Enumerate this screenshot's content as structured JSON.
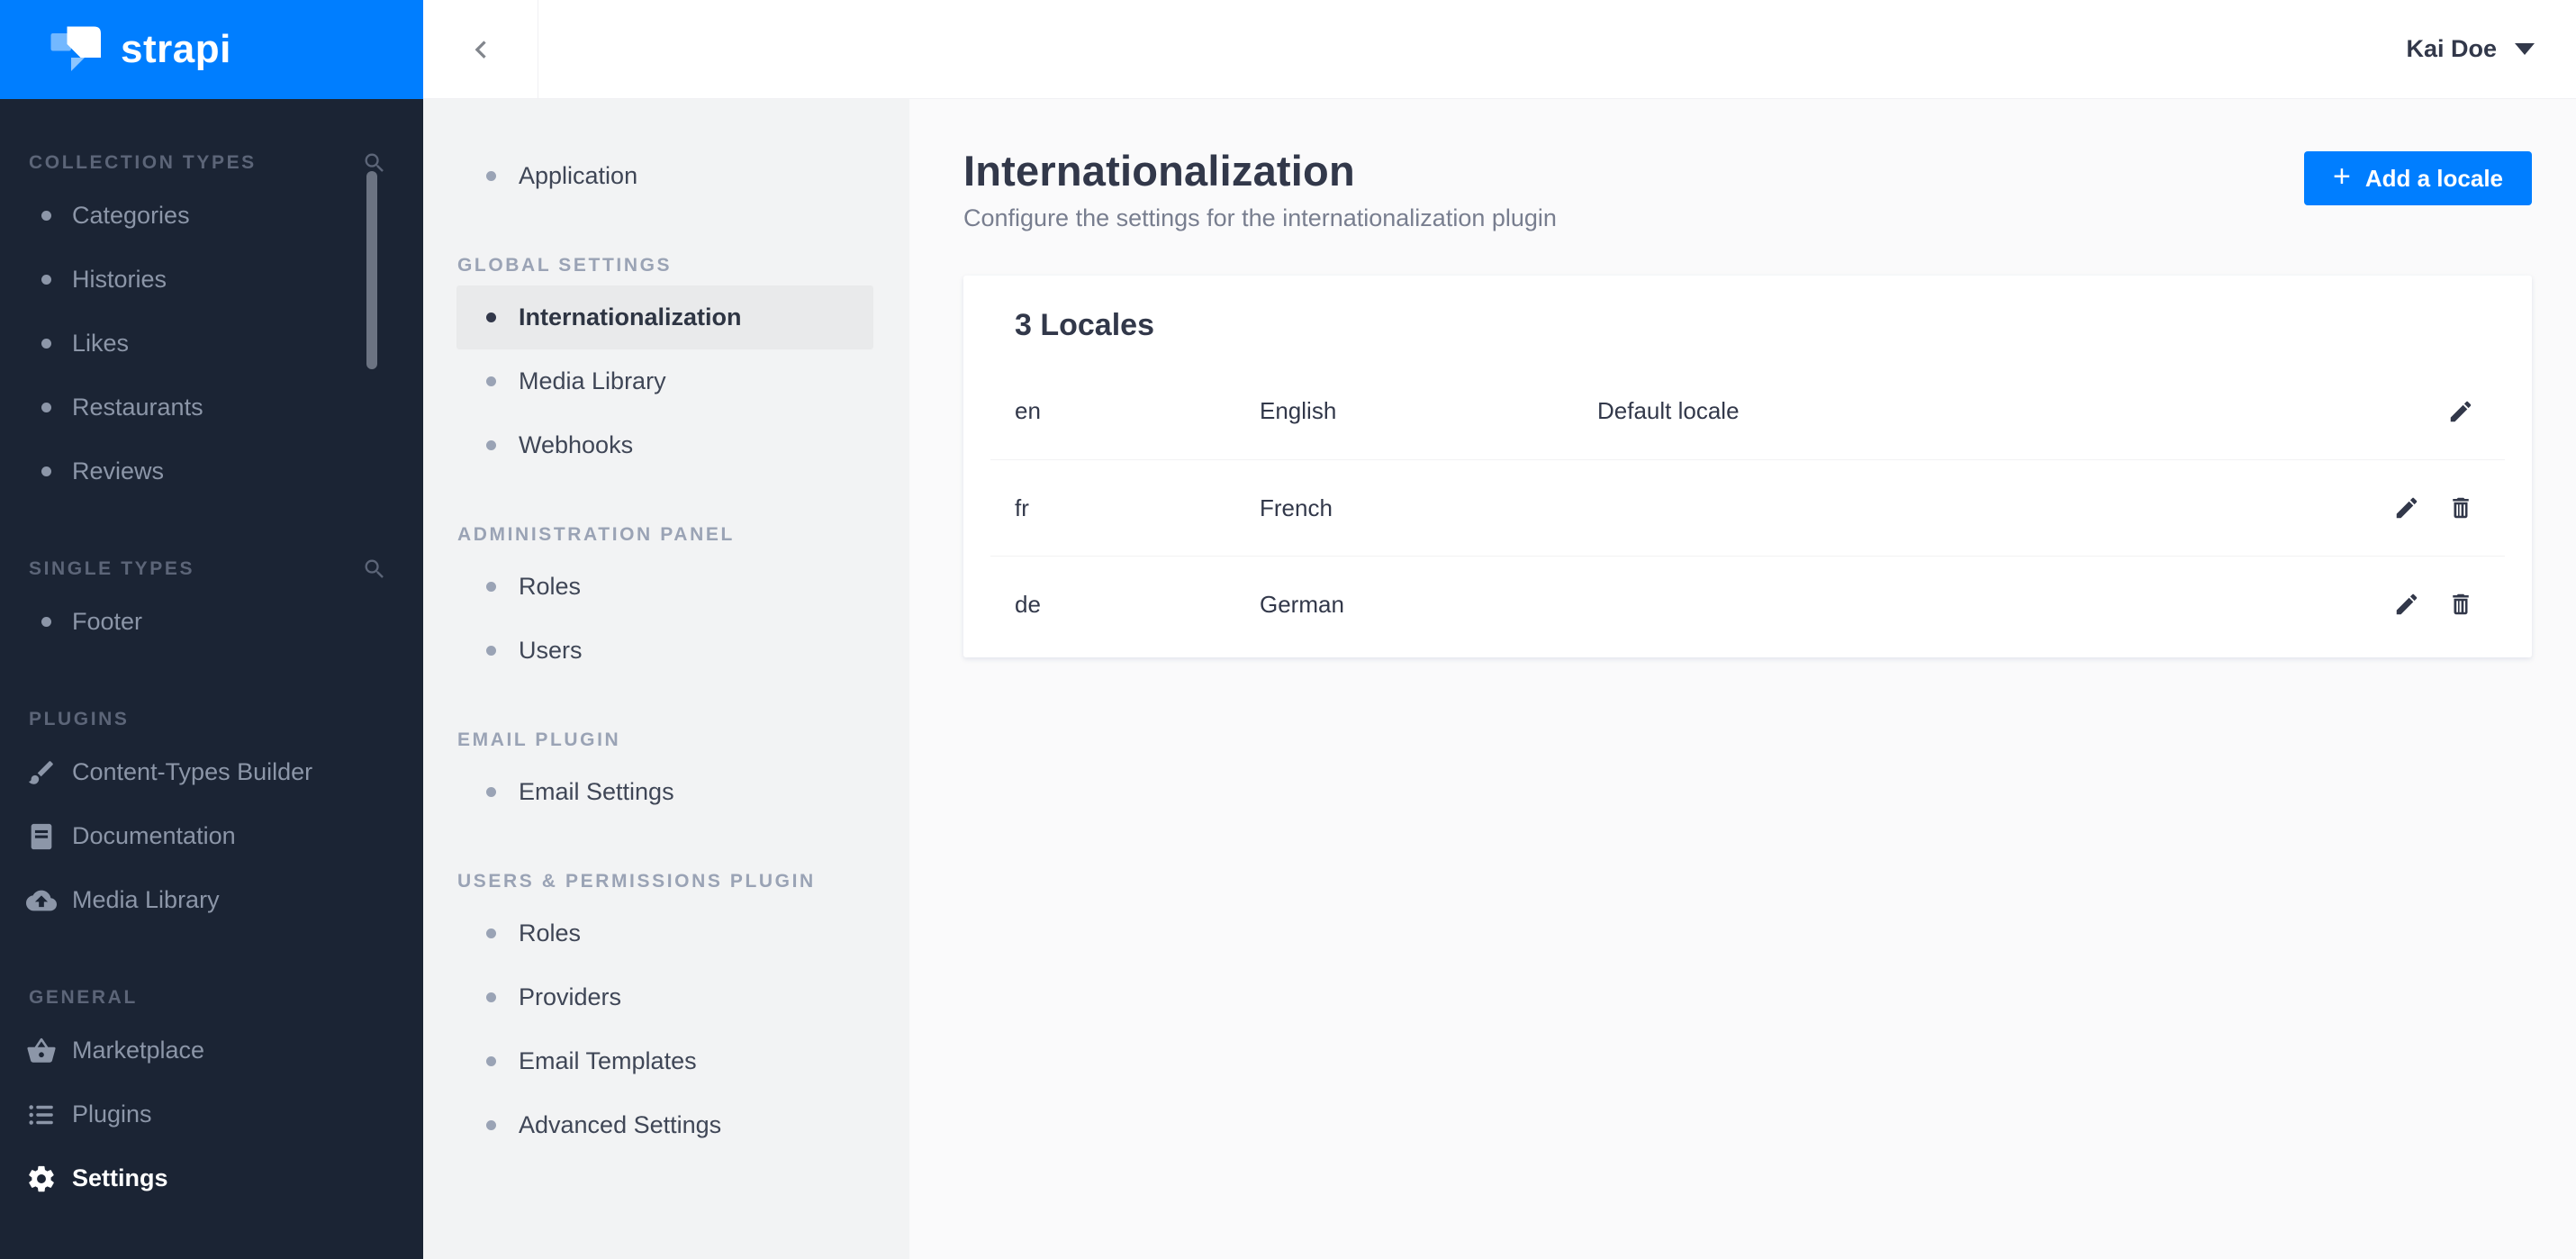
{
  "brand": {
    "name": "strapi"
  },
  "colors": {
    "brand_blue": "#007eff",
    "sidebar_dark": "#1b2434",
    "sidebar_light": "#f2f3f4",
    "main_bg": "#fafafb",
    "text_dark": "#32384a",
    "text_muted": "#787e8f"
  },
  "topbar": {
    "user_name": "Kai Doe"
  },
  "left_sidebar": {
    "sections": [
      {
        "label": "COLLECTION TYPES",
        "has_search": true,
        "items": [
          {
            "label": "Categories"
          },
          {
            "label": "Histories"
          },
          {
            "label": "Likes"
          },
          {
            "label": "Restaurants"
          },
          {
            "label": "Reviews"
          }
        ]
      },
      {
        "label": "SINGLE TYPES",
        "has_search": true,
        "items": [
          {
            "label": "Footer"
          }
        ]
      },
      {
        "label": "PLUGINS",
        "items": [
          {
            "label": "Content-Types Builder",
            "icon": "brush-icon"
          },
          {
            "label": "Documentation",
            "icon": "book-icon"
          },
          {
            "label": "Media Library",
            "icon": "cloud-upload-icon"
          }
        ]
      },
      {
        "label": "GENERAL",
        "items": [
          {
            "label": "Marketplace",
            "icon": "basket-icon"
          },
          {
            "label": "Plugins",
            "icon": "list-icon"
          },
          {
            "label": "Settings",
            "icon": "gear-icon",
            "active": true
          }
        ]
      }
    ]
  },
  "settings_sidebar": {
    "top_items": [
      {
        "label": "Application"
      }
    ],
    "sections": [
      {
        "label": "GLOBAL SETTINGS",
        "items": [
          {
            "label": "Internationalization",
            "active": true
          },
          {
            "label": "Media Library"
          },
          {
            "label": "Webhooks"
          }
        ]
      },
      {
        "label": "ADMINISTRATION PANEL",
        "items": [
          {
            "label": "Roles"
          },
          {
            "label": "Users"
          }
        ]
      },
      {
        "label": "EMAIL PLUGIN",
        "items": [
          {
            "label": "Email Settings"
          }
        ]
      },
      {
        "label": "USERS & PERMISSIONS PLUGIN",
        "items": [
          {
            "label": "Roles"
          },
          {
            "label": "Providers"
          },
          {
            "label": "Email Templates"
          },
          {
            "label": "Advanced Settings"
          }
        ]
      }
    ]
  },
  "main": {
    "title": "Internationalization",
    "subtitle": "Configure the settings for the internationalization plugin",
    "add_button": {
      "plus": "+",
      "label": "Add a locale"
    },
    "locales_card": {
      "title": "3 Locales",
      "rows": [
        {
          "code": "en",
          "name": "English",
          "status": "Default locale"
        },
        {
          "code": "fr",
          "name": "French",
          "status": ""
        },
        {
          "code": "de",
          "name": "German",
          "status": ""
        }
      ]
    }
  }
}
